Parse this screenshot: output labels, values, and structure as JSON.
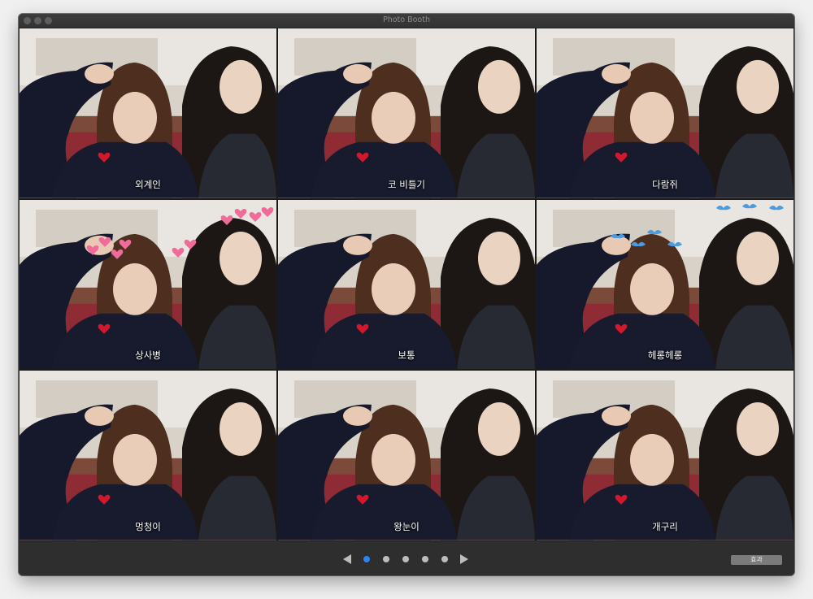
{
  "window": {
    "title": "Photo Booth"
  },
  "effects": [
    {
      "label": "외계인",
      "overlay": "none"
    },
    {
      "label": "코 비틀기",
      "overlay": "none"
    },
    {
      "label": "다람쥐",
      "overlay": "none"
    },
    {
      "label": "상사병",
      "overlay": "hearts"
    },
    {
      "label": "보통",
      "overlay": "none"
    },
    {
      "label": "헤롱헤롱",
      "overlay": "birds"
    },
    {
      "label": "멍청이",
      "overlay": "none"
    },
    {
      "label": "왕눈이",
      "overlay": "none"
    },
    {
      "label": "개구리",
      "overlay": "none"
    }
  ],
  "pagination": {
    "page_count": 5,
    "current_page": 1
  },
  "toolbar": {
    "effects_button_label": "효과"
  },
  "colors": {
    "active_dot": "#2c86f0",
    "inactive_dot": "#bdbdbd",
    "heart": "#f06a9a",
    "bird": "#4a9be0"
  }
}
